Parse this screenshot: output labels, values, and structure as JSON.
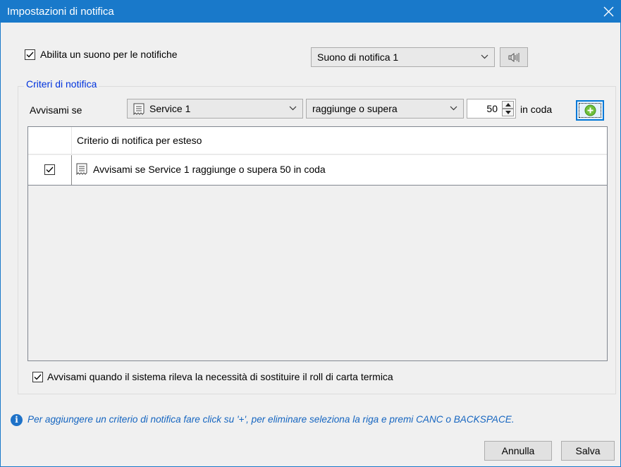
{
  "window": {
    "title": "Impostazioni di notifica",
    "accent": "#1979ca"
  },
  "sound": {
    "checkbox_label": "Abilita un suono per le notifiche",
    "checked": true,
    "selected_sound": "Suono di notifica 1",
    "play_icon": "speaker-icon"
  },
  "criteria": {
    "group_title": "Criteri di notifica",
    "notify_if_label": "Avvisami se",
    "service_selected": "Service 1",
    "condition_selected": "raggiunge o supera",
    "threshold": "50",
    "unit_label": "in coda",
    "add_icon": "plus-circle-icon"
  },
  "table": {
    "header": "Criterio di notifica per esteso",
    "rows": [
      {
        "checked": true,
        "text": "Avvisami se Service 1 raggiunge o supera 50 in coda"
      }
    ]
  },
  "paper": {
    "checkbox_label": "Avvisami quando il sistema rileva la necessità di sostituire il roll di carta termica",
    "checked": true
  },
  "info": {
    "text": "Per aggiungere un criterio di notifica fare click su '+', per eliminare seleziona la riga e premi CANC o BACKSPACE."
  },
  "buttons": {
    "cancel": "Annulla",
    "save": "Salva"
  }
}
